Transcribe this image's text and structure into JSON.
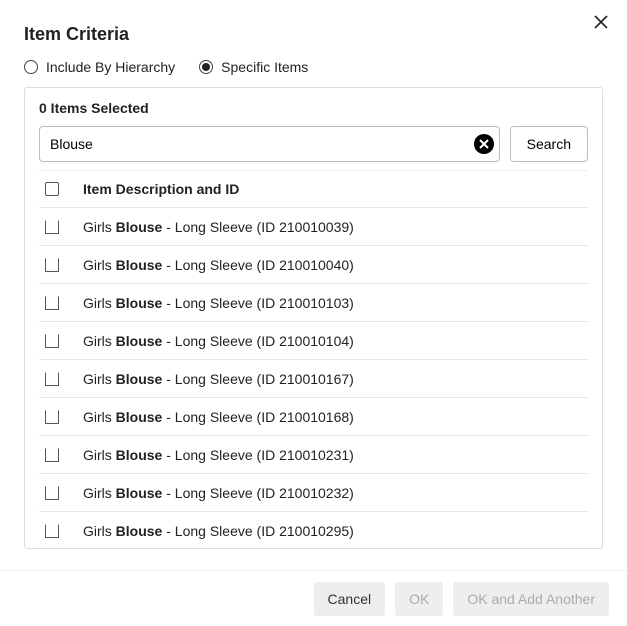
{
  "dialog": {
    "title": "Item Criteria"
  },
  "mode": {
    "options": [
      {
        "label": "Include By Hierarchy",
        "selected": false
      },
      {
        "label": "Specific Items",
        "selected": true
      }
    ]
  },
  "selection": {
    "count_label": "0 Items Selected"
  },
  "search": {
    "value": "Blouse",
    "button_label": "Search"
  },
  "table": {
    "header": "Item Description and ID",
    "match": "Blouse",
    "rows": [
      {
        "prefix": "Girls ",
        "match": "Blouse",
        "suffix": " - Long Sleeve (ID 210010039)"
      },
      {
        "prefix": "Girls ",
        "match": "Blouse",
        "suffix": " - Long Sleeve (ID 210010040)"
      },
      {
        "prefix": "Girls ",
        "match": "Blouse",
        "suffix": " - Long Sleeve (ID 210010103)"
      },
      {
        "prefix": "Girls ",
        "match": "Blouse",
        "suffix": " - Long Sleeve (ID 210010104)"
      },
      {
        "prefix": "Girls ",
        "match": "Blouse",
        "suffix": " - Long Sleeve (ID 210010167)"
      },
      {
        "prefix": "Girls ",
        "match": "Blouse",
        "suffix": " - Long Sleeve (ID 210010168)"
      },
      {
        "prefix": "Girls ",
        "match": "Blouse",
        "suffix": " - Long Sleeve (ID 210010231)"
      },
      {
        "prefix": "Girls ",
        "match": "Blouse",
        "suffix": " - Long Sleeve (ID 210010232)"
      },
      {
        "prefix": "Girls ",
        "match": "Blouse",
        "suffix": " - Long Sleeve (ID 210010295)"
      }
    ]
  },
  "footer": {
    "cancel": "Cancel",
    "ok": "OK",
    "ok_add": "OK and Add Another"
  }
}
